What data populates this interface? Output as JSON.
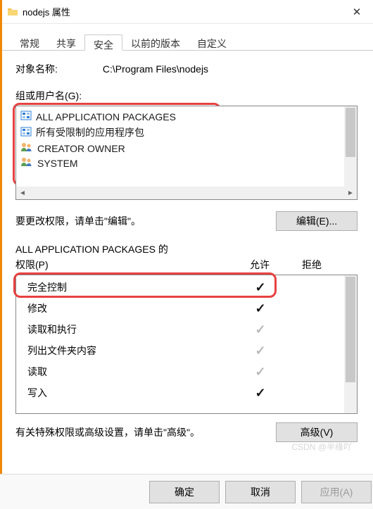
{
  "titlebar": {
    "title": "nodejs 属性",
    "close": "✕"
  },
  "tabs": [
    {
      "label": "常规"
    },
    {
      "label": "共享"
    },
    {
      "label": "安全"
    },
    {
      "label": "以前的版本"
    },
    {
      "label": "自定义"
    }
  ],
  "active_tab_index": 2,
  "object": {
    "label": "对象名称:",
    "value": "C:\\Program Files\\nodejs"
  },
  "groups_label": "组或用户名(G):",
  "groups": [
    {
      "type": "pkg",
      "name": "ALL APPLICATION PACKAGES"
    },
    {
      "type": "pkg",
      "name": "所有受限制的应用程序包"
    },
    {
      "type": "usr",
      "name": "CREATOR OWNER"
    },
    {
      "type": "usr",
      "name": "SYSTEM"
    }
  ],
  "edit_hint": "要更改权限，请单击\"编辑\"。",
  "edit_btn": "编辑(E)...",
  "perm_title": "ALL APPLICATION PACKAGES 的",
  "perm_label": "权限(P)",
  "allow_label": "允许",
  "deny_label": "拒绝",
  "permissions": [
    {
      "name": "完全控制",
      "allow": "dark",
      "deny": ""
    },
    {
      "name": "修改",
      "allow": "dark",
      "deny": ""
    },
    {
      "name": "读取和执行",
      "allow": "grey",
      "deny": ""
    },
    {
      "name": "列出文件夹内容",
      "allow": "grey",
      "deny": ""
    },
    {
      "name": "读取",
      "allow": "grey",
      "deny": ""
    },
    {
      "name": "写入",
      "allow": "dark",
      "deny": ""
    }
  ],
  "adv_hint": "有关特殊权限或高级设置，请单击\"高级\"。",
  "adv_btn": "高级(V)",
  "footer": {
    "ok": "确定",
    "cancel": "取消",
    "apply": "应用(A)"
  },
  "watermark": "CSDN @半缘吖"
}
